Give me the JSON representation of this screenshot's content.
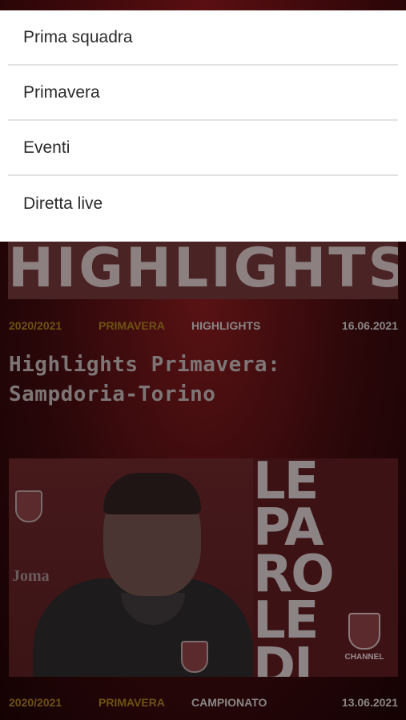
{
  "menu": {
    "items": [
      {
        "label": "Prima squadra"
      },
      {
        "label": "Primavera"
      },
      {
        "label": "Eventi"
      },
      {
        "label": "Diretta live"
      }
    ]
  },
  "articles": [
    {
      "banner_text": "HIGHLIGHTS",
      "season": "2020/2021",
      "category": "PRIMAVERA",
      "tag": "HIGHLIGHTS",
      "date": "16.06.2021",
      "title_line1": "Highlights Primavera:",
      "title_line2": "Sampdoria-Torino"
    },
    {
      "thumbnail_letters": [
        "LE",
        "PA",
        "RO",
        "LE",
        "DI"
      ],
      "sponsor": "Joma",
      "channel_label": "CHANNEL",
      "crest_label": "TORINO",
      "season": "2020/2021",
      "category": "PRIMAVERA",
      "tag": "CAMPIONATO",
      "date": "13.06.2021"
    }
  ],
  "colors": {
    "menu_background": "#ffffff",
    "overlay_background": "#2a0709",
    "category_accent": "#6e5214"
  }
}
